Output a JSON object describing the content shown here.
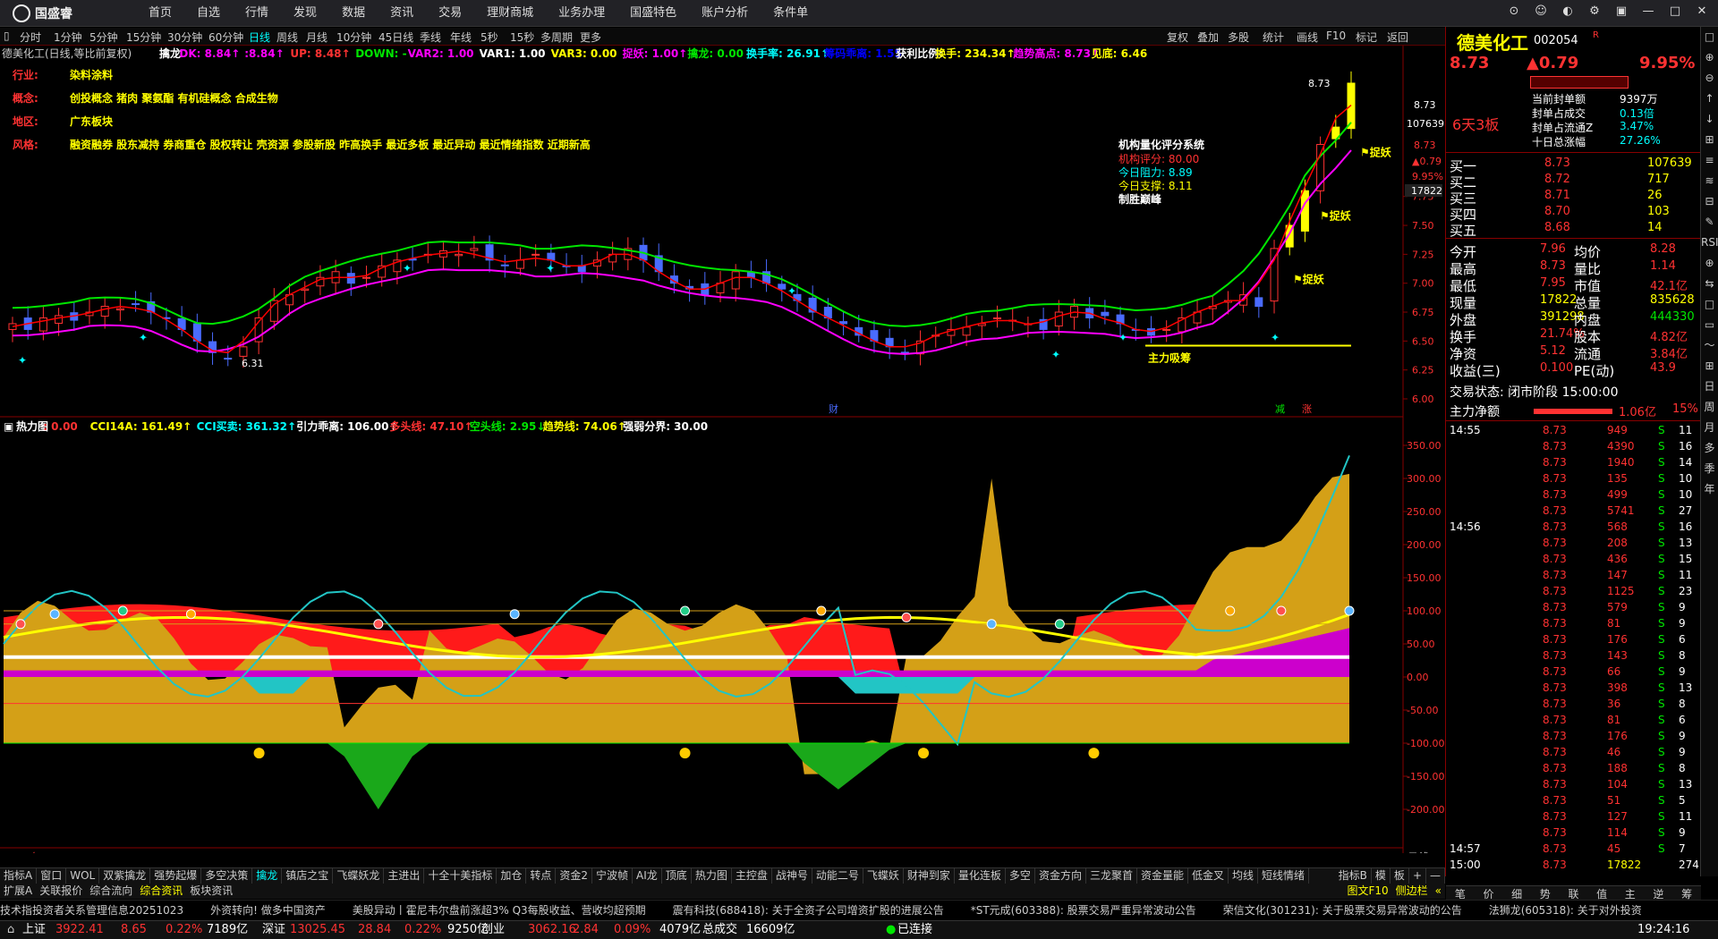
{
  "app": {
    "name": "国盛睿"
  },
  "nav": [
    "首页",
    "自选",
    "行情",
    "发现",
    "数据",
    "资讯",
    "交易",
    "理财商城",
    "业务办理",
    "国盛特色",
    "账户分析",
    "条件单"
  ],
  "periods": [
    "分时",
    "1分钟",
    "5分钟",
    "15分钟",
    "30分钟",
    "60分钟",
    "日线",
    "周线",
    "月线",
    "10分钟",
    "45日线",
    "季线",
    "年线",
    "5秒",
    "15秒",
    "多周期",
    "更多"
  ],
  "toolbar": [
    "复权",
    "叠加",
    "多股",
    "统计",
    "画线",
    "F10",
    "标记",
    "返回"
  ],
  "indicator_line": {
    "stock": "德美化工(日线,等比前复权)",
    "items": [
      {
        "t": "擒龙",
        "c": "#ffffff"
      },
      {
        "t": "DK: 8.84↑",
        "c": "#ff00ff"
      },
      {
        "t": ":8.84↑",
        "c": "#ff00ff"
      },
      {
        "t": "UP: 8.48↑",
        "c": "#ff3232"
      },
      {
        "t": "DOWN: -",
        "c": "#00e600"
      },
      {
        "t": "VAR2: 1.00",
        "c": "#ff00ff"
      },
      {
        "t": "VAR1: 1.00",
        "c": "#ffffff"
      },
      {
        "t": "VAR3: 0.00",
        "c": "#ffff00"
      },
      {
        "t": "捉妖: 1.00↑",
        "c": "#ff00ff"
      },
      {
        "t": "擒龙: 0.00",
        "c": "#00e600"
      },
      {
        "t": "换手率: 26.91↑",
        "c": "#00ffff"
      },
      {
        "t": "筹码乖离: 1.55",
        "c": "#0000ff"
      },
      {
        "t": "获利比例:",
        "c": "#ffffff"
      },
      {
        "t": "换手: 234.34↑",
        "c": "#ffff00"
      },
      {
        "t": "趋势高点: 8.73↑",
        "c": "#ff00ff"
      },
      {
        "t": "见底: 6.46",
        "c": "#ffff00"
      }
    ]
  },
  "info_block": {
    "rows": [
      {
        "k": "行业:",
        "v": "染料涂料"
      },
      {
        "k": "概念:",
        "v": "创投概念 猪肉 聚氨酯 有机硅概念 合成生物"
      },
      {
        "k": "地区:",
        "v": "广东板块"
      },
      {
        "k": "风格:",
        "v": "融资融券 股东减持 券商重仓 股权转让 壳资源 参股新股 昨高换手 最近多板 最近异动 最近情绪指数 近期新高"
      }
    ]
  },
  "rating": {
    "title": "机构量化评分系统",
    "score_label": "机构评分:",
    "score": "80.00",
    "resist_label": "今日阻力:",
    "resist": "8.89",
    "support_label": "今日支撑:",
    "support": "8.11",
    "verdict": "制胜巅峰"
  },
  "annotations": {
    "zhuoyao": "捉妖",
    "main_absorb": "主力吸筹",
    "peak_price": "8.73",
    "low_price": "6.31",
    "cai": "财",
    "jian": "减",
    "zhang": "涨"
  },
  "price_axis": [
    "8.73",
    "8.73",
    "7.75",
    "7.50",
    "7.25",
    "7.00",
    "6.75",
    "6.50",
    "6.25",
    "6.00"
  ],
  "price_axis_flags": {
    "pct": "8.73",
    "chg": "0.79",
    "pctv": "9.95%",
    "vol": "107639",
    "vol2": "17822"
  },
  "lower_indicator": {
    "items": [
      {
        "t": "热力图",
        "c": "#ffffff"
      },
      {
        "t": ": 0.00",
        "c": "#ff3232"
      },
      {
        "t": "CCI14A: 161.49↑",
        "c": "#ffff00"
      },
      {
        "t": "CCI买卖: 361.32↑",
        "c": "#00ffff"
      },
      {
        "t": "引力乖离: 106.00↑",
        "c": "#ffffff"
      },
      {
        "t": "多头线: 47.10↑",
        "c": "#ff3232"
      },
      {
        "t": "空头线: 2.95↓",
        "c": "#00e600"
      },
      {
        "t": "趋势线: 74.06↑",
        "c": "#ffff00"
      },
      {
        "t": "强弱分界: 30.00",
        "c": "#ffffff"
      }
    ],
    "axis": [
      "350.00",
      "300.00",
      "250.00",
      "200.00",
      "150.00",
      "100.00",
      "50.00",
      "0.00",
      "-50.00",
      "-100.00",
      "-150.00",
      "-200.00"
    ]
  },
  "date_axis": {
    "year": "2025年",
    "m6": "6",
    "m7": "7",
    "m8": "8",
    "m9": "9",
    "m10": "10",
    "period": "日线"
  },
  "chart_data": {
    "type": "candlestick",
    "title": "德美化工(日线,等比前复权)",
    "ylim": [
      6.0,
      8.9
    ],
    "months": [
      "6",
      "7",
      "8",
      "9",
      "10"
    ],
    "closes": [
      6.65,
      6.6,
      6.7,
      6.72,
      6.68,
      6.75,
      6.8,
      6.78,
      6.82,
      6.75,
      6.7,
      6.6,
      6.5,
      6.4,
      6.35,
      6.45,
      6.7,
      6.85,
      6.9,
      6.95,
      7.05,
      7.1,
      7.0,
      7.05,
      7.15,
      7.2,
      7.2,
      7.25,
      7.28,
      7.25,
      7.3,
      7.2,
      7.15,
      7.2,
      7.25,
      7.2,
      7.15,
      7.1,
      7.2,
      7.25,
      7.3,
      7.2,
      7.1,
      7.0,
      6.95,
      6.9,
      7.0,
      7.1,
      7.05,
      7.0,
      6.95,
      6.85,
      6.75,
      6.7,
      6.65,
      6.55,
      6.5,
      6.45,
      6.4,
      6.5,
      6.55,
      6.6,
      6.62,
      6.65,
      6.7,
      6.68,
      6.65,
      6.6,
      6.75,
      6.8,
      6.7,
      6.72,
      6.65,
      6.6,
      6.55,
      6.6,
      6.7,
      6.75,
      6.8,
      6.85,
      6.9,
      6.8,
      7.3,
      7.5,
      7.8,
      8.2,
      8.35,
      8.73
    ]
  },
  "quote": {
    "name": "德美化工",
    "code": "002054",
    "badge": "R",
    "price": "8.73",
    "change": "▲0.79",
    "pct": "9.95%",
    "tag": "6天3板",
    "seal": [
      {
        "k": "当前封单额",
        "v": "9397万"
      },
      {
        "k": "封单占成交",
        "v": "0.13倍"
      },
      {
        "k": "封单占流通Z",
        "v": "3.47%"
      },
      {
        "k": "十日总涨幅",
        "v": "27.26%"
      }
    ],
    "book": [
      {
        "k": "买一",
        "p": "8.73",
        "v": "107639"
      },
      {
        "k": "买二",
        "p": "8.72",
        "v": "717"
      },
      {
        "k": "买三",
        "p": "8.71",
        "v": "26"
      },
      {
        "k": "买四",
        "p": "8.70",
        "v": "103"
      },
      {
        "k": "买五",
        "p": "8.68",
        "v": "14"
      }
    ],
    "stats": [
      {
        "k1": "今开",
        "v1": "7.96",
        "k2": "均价",
        "v2": "8.28"
      },
      {
        "k1": "最高",
        "v1": "8.73",
        "k2": "量比",
        "v2": "1.14"
      },
      {
        "k1": "最低",
        "v1": "7.95",
        "k2": "市值",
        "v2": "42.1亿"
      },
      {
        "k1": "现量",
        "v1": "17822",
        "k2": "总量",
        "v2": "835628"
      },
      {
        "k1": "外盘",
        "v1": "391298",
        "k2": "内盘",
        "v2": "444330"
      },
      {
        "k1": "换手",
        "v1": "21.74%",
        "k2": "股本",
        "v2": "4.82亿"
      },
      {
        "k1": "净资",
        "v1": "5.12",
        "k2": "流通",
        "v2": "3.84亿"
      },
      {
        "k1": "收益(三)",
        "v1": "0.100",
        "k2": "PE(动)",
        "v2": "43.9"
      }
    ],
    "trade_state": "交易状态: 闭市阶段 15:00:00",
    "net_label": "主力净额",
    "net": "1.06亿",
    "net_pct": "15%",
    "ticks_time1": "14:55",
    "ticks_time2": "14:56",
    "ticks_time3": "14:57",
    "ticks_time4": "15:00",
    "ticks": [
      [
        "8.73",
        "949",
        "S",
        "11"
      ],
      [
        "8.73",
        "4390",
        "S",
        "16"
      ],
      [
        "8.73",
        "1940",
        "S",
        "14"
      ],
      [
        "8.73",
        "135",
        "S",
        "10"
      ],
      [
        "8.73",
        "499",
        "S",
        "10"
      ],
      [
        "8.73",
        "5741",
        "S",
        "27"
      ],
      [
        "8.73",
        "568",
        "S",
        "16"
      ],
      [
        "8.73",
        "208",
        "S",
        "13"
      ],
      [
        "8.73",
        "436",
        "S",
        "15"
      ],
      [
        "8.73",
        "147",
        "S",
        "11"
      ],
      [
        "8.73",
        "1125",
        "S",
        "23"
      ],
      [
        "8.73",
        "579",
        "S",
        "9"
      ],
      [
        "8.73",
        "81",
        "S",
        "9"
      ],
      [
        "8.73",
        "176",
        "S",
        "6"
      ],
      [
        "8.73",
        "143",
        "S",
        "8"
      ],
      [
        "8.73",
        "66",
        "S",
        "9"
      ],
      [
        "8.73",
        "398",
        "S",
        "13"
      ],
      [
        "8.73",
        "36",
        "S",
        "8"
      ],
      [
        "8.73",
        "81",
        "S",
        "6"
      ],
      [
        "8.73",
        "176",
        "S",
        "9"
      ],
      [
        "8.73",
        "46",
        "S",
        "9"
      ],
      [
        "8.73",
        "188",
        "S",
        "8"
      ],
      [
        "8.73",
        "104",
        "S",
        "13"
      ],
      [
        "8.73",
        "51",
        "S",
        "5"
      ],
      [
        "8.73",
        "127",
        "S",
        "11"
      ],
      [
        "8.73",
        "114",
        "S",
        "9"
      ],
      [
        "8.73",
        "45",
        "S",
        "7"
      ],
      [
        "8.73",
        "17822",
        "",
        "274"
      ]
    ],
    "bottom_tabs": [
      "笔",
      "价",
      "细",
      "势",
      "联",
      "值",
      "主",
      "逆",
      "筹"
    ]
  },
  "vtools": [
    "□",
    "⊕",
    "⊖",
    "↑",
    "↓",
    "⊞",
    "≡",
    "≋",
    "⊟",
    "✎",
    "RSI",
    "⊕",
    "⇆",
    "□",
    "▭",
    "〜",
    "⊞",
    "日",
    "周",
    "月",
    "多",
    "季",
    "年"
  ],
  "tabs1": [
    "指标A",
    "窗口",
    "WOL",
    "双紫擒龙",
    "强势起爆",
    "多空决策",
    "擒龙",
    "镇店之宝",
    "飞蝶妖龙",
    "主进出",
    "十全十美指标",
    "加仓",
    "转点",
    "资金2",
    "宁波帧",
    "AI龙",
    "顶底",
    "热力图",
    "主控盘",
    "战神号",
    "动能二号",
    "飞蝶妖",
    "财神到家",
    "量化连板",
    "多空",
    "资金方向",
    "三龙聚首",
    "资金量能",
    "低金叉",
    "均线",
    "短线情绪"
  ],
  "tabs1_right": [
    "指标B",
    "模",
    "板",
    "+",
    "—"
  ],
  "tabs2": [
    "扩展A",
    "关联报价",
    "综合流向",
    "综合资讯",
    "板块资讯"
  ],
  "tabs2_right": [
    "图文F10",
    "侧边栏",
    "«"
  ],
  "ticker": [
    "技术指投资者关系管理信息20251023",
    "外资转向! 做多中国资产",
    "美股异动丨霍尼韦尔盘前涨超3% Q3每股收益、营收均超预期",
    "震有科技(688418): 关于全资子公司增资扩股的进展公告",
    "*ST元成(603388): 股票交易严重异常波动公告",
    "荣信文化(301231): 关于股票交易异常波动的公告",
    "法狮龙(605318): 关于对外投资"
  ],
  "status": {
    "sh_label": "上证",
    "sh": "3922.41",
    "sh_chg": "8.65",
    "sh_pct": "0.22%",
    "sh_amt": "7189亿",
    "sz_label": "深证",
    "sz": "13025.45",
    "sz_chg": "28.84",
    "sz_pct": "0.22%",
    "sz_amt": "9250亿",
    "cy_label": "创业",
    "cy": "3062.16",
    "cy_chg": "2.84",
    "cy_pct": "0.09%",
    "cy_amt": "4079亿",
    "total_label": "总成交",
    "total": "16609亿",
    "conn": "已连接",
    "time": "19:24:16"
  }
}
